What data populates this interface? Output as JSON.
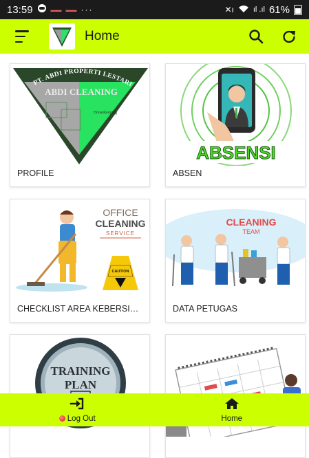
{
  "status_bar": {
    "time": "13:59",
    "battery_percent": "61%",
    "network_text": "ıl .ıl"
  },
  "app_bar": {
    "title": "Home",
    "icons": [
      "menu-icon",
      "search-icon",
      "refresh-icon"
    ]
  },
  "cards": [
    {
      "label": "PROFILE",
      "image": "company-logo",
      "logo_title": "PT. ABDI PROPERTI LESTARI",
      "logo_subtitle": "ABDI CLEANING",
      "logo_tag": "Housekeeping"
    },
    {
      "label": "ABSEN",
      "image": "absensi-phone",
      "image_text": "ABSENSI"
    },
    {
      "label": "CHECKLIST AREA KEBERSIHAN",
      "image": "office-cleaning-service",
      "image_title": "OFFICE",
      "image_title2": "CLEANING",
      "image_title3": "SERVICE",
      "sign_text": "CAUTION"
    },
    {
      "label": "DATA PETUGAS",
      "image": "cleaning-team",
      "image_title": "CLEANING",
      "image_subtitle": "TEAM"
    },
    {
      "label": "",
      "image": "training-plan",
      "image_title": "TRAINING",
      "image_subtitle": "PLAN"
    },
    {
      "label": "",
      "image": "schedule-calendar"
    }
  ],
  "bottom_nav": {
    "logout_label": "Log Out",
    "home_label": "Home"
  },
  "colors": {
    "accent": "#ccff00",
    "status_bar": "#1b1b1b",
    "logout_dot": "#d01818"
  }
}
